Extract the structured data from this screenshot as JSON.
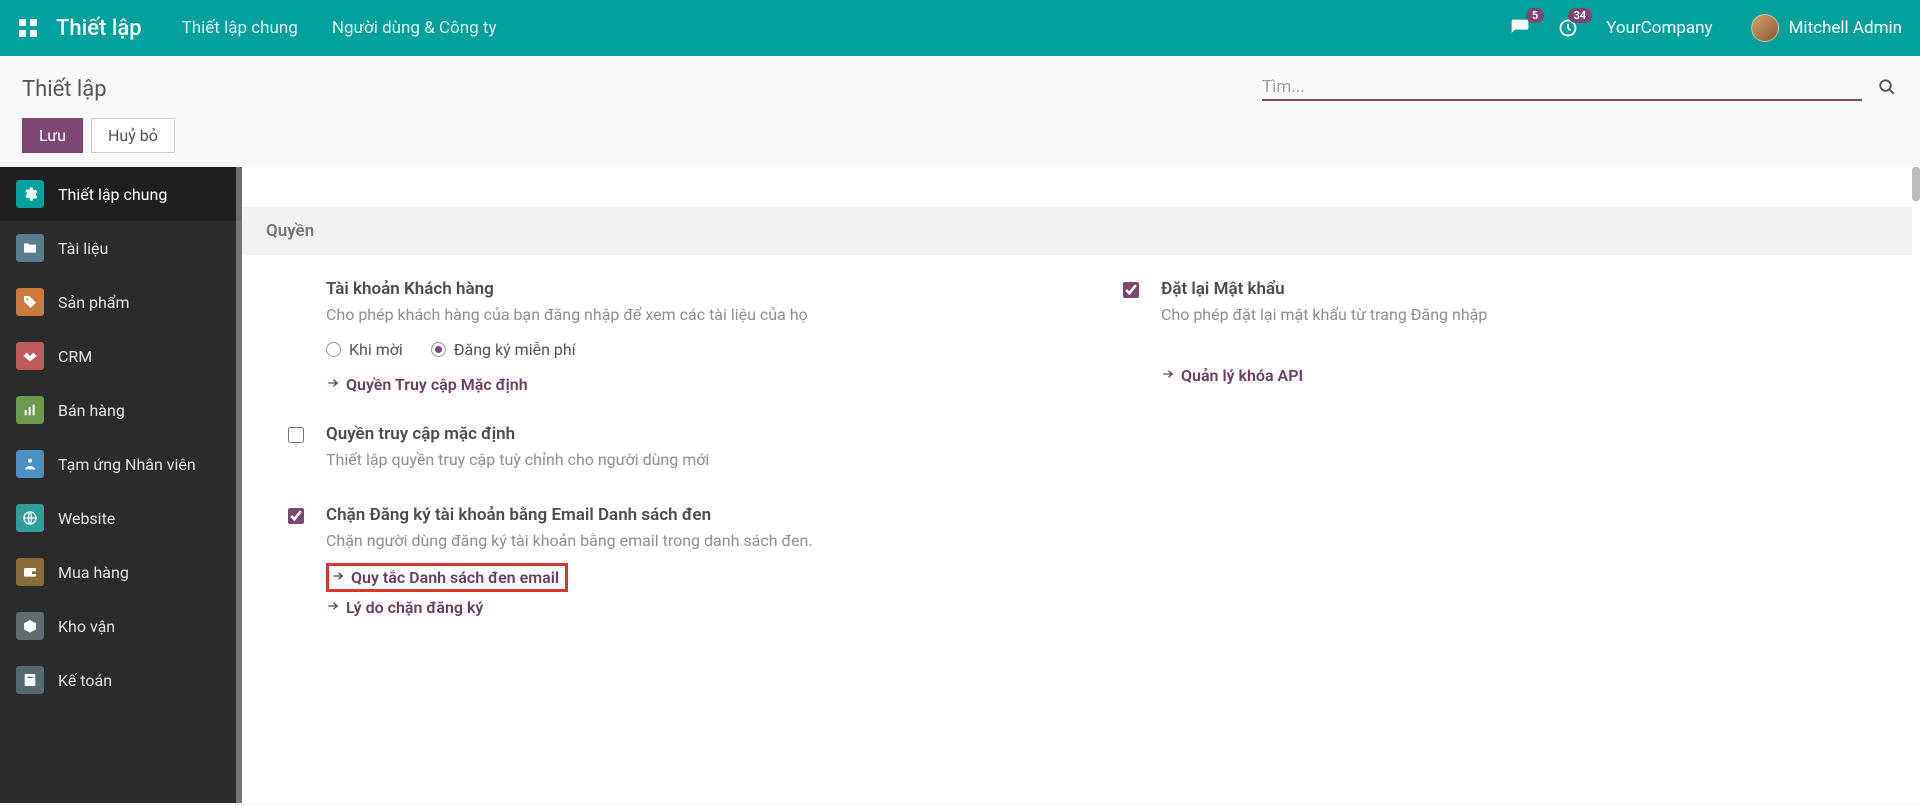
{
  "navbar": {
    "brand": "Thiết lập",
    "menu": {
      "general": "Thiết lập chung",
      "users": "Người dùng & Công ty"
    },
    "chat_badge": "5",
    "activity_badge": "34",
    "company": "YourCompany",
    "user_name": "Mitchell Admin"
  },
  "breadcrumb": {
    "title": "Thiết lập"
  },
  "search": {
    "placeholder": "Tìm..."
  },
  "buttons": {
    "save": "Lưu",
    "discard": "Huỷ bỏ"
  },
  "sidebar": {
    "items": [
      {
        "label": "Thiết lập chung"
      },
      {
        "label": "Tài liệu"
      },
      {
        "label": "Sản phẩm"
      },
      {
        "label": "CRM"
      },
      {
        "label": "Bán hàng"
      },
      {
        "label": "Tạm ứng Nhân viên"
      },
      {
        "label": "Website"
      },
      {
        "label": "Mua hàng"
      },
      {
        "label": "Kho vận"
      },
      {
        "label": "Kế toán"
      }
    ]
  },
  "section": {
    "rights": "Quyền"
  },
  "settings": {
    "customer_account": {
      "title": "Tài khoản Khách hàng",
      "desc": "Cho phép khách hàng của bạn đăng nhập để xem các tài liệu của họ",
      "radio1": "Khi mời",
      "radio2": "Đăng ký miễn phí",
      "link": "Quyền Truy cập Mặc định"
    },
    "default_access": {
      "title": "Quyền truy cập mặc định",
      "desc": "Thiết lập quyền truy cập tuỳ chỉnh cho người dùng mới"
    },
    "blacklist": {
      "title": "Chặn Đăng ký tài khoản bằng Email Danh sách đen",
      "desc": "Chặn người dùng đăng ký tài khoản bằng email trong danh sách đen.",
      "link1": "Quy tắc Danh sách đen email",
      "link2": "Lý do chặn đăng ký"
    },
    "reset_pw": {
      "title": "Đặt lại Mật khẩu",
      "desc": "Cho phép đặt lại mật khẩu từ trang Đăng nhập"
    },
    "api_keys": {
      "link": "Quản lý khóa API"
    }
  }
}
